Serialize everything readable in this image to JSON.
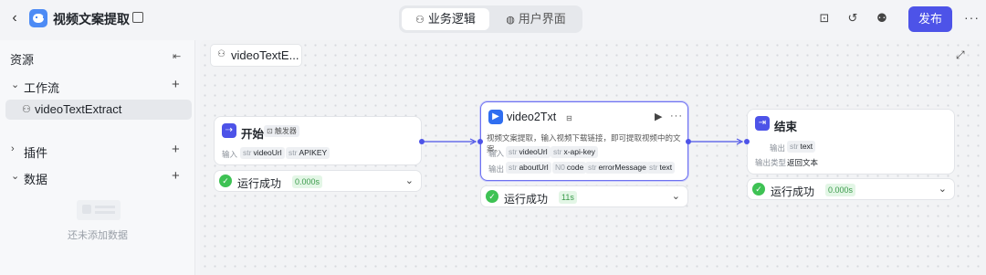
{
  "header": {
    "back_icon": "chevron-left-icon",
    "app_title": "视频文案提取",
    "tabs": [
      {
        "label": "业务逻辑",
        "icon": "flow-icon",
        "active": true
      },
      {
        "label": "用户界面",
        "icon": "palette-icon",
        "active": false
      }
    ],
    "publish_label": "发布",
    "publish_color": "#4d53e8"
  },
  "sidebar": {
    "title": "资源",
    "sections": [
      {
        "label": "工作流",
        "expanded": true
      },
      {
        "label": "插件",
        "expanded": false
      },
      {
        "label": "数据",
        "expanded": true
      }
    ],
    "workflow_item": "videoTextExtract",
    "empty_text": "还未添加数据"
  },
  "canvas": {
    "tab_label": "videoTextE...",
    "nodes": {
      "start": {
        "title": "开始",
        "badge": "⊡ 触发器",
        "input_label": "输入",
        "inputs": [
          {
            "type": "str",
            "name": "videoUrl"
          },
          {
            "type": "str",
            "name": "APIKEY"
          }
        ],
        "status": "运行成功",
        "time": "0.000s"
      },
      "video": {
        "title": "video2Txt",
        "description": "视频文案提取，输入视频下载链接，即可提取视频中的文案。",
        "input_label": "输入",
        "inputs": [
          {
            "type": "str",
            "name": "videoUrl"
          },
          {
            "type": "str",
            "name": "x-api-key"
          }
        ],
        "output_label": "输出",
        "outputs": [
          {
            "type": "str",
            "name": "aboutUrl"
          },
          {
            "type": "N0",
            "name": "code"
          },
          {
            "type": "str",
            "name": "errorMessage"
          },
          {
            "type": "str",
            "name": "text"
          }
        ],
        "status": "运行成功",
        "time": "11s"
      },
      "end": {
        "title": "结束",
        "output_label": "输出",
        "outputs": [
          {
            "type": "str",
            "name": "text"
          }
        ],
        "output_type_label": "输出类型",
        "output_type_value": "返回文本",
        "status": "运行成功",
        "time": "0.000s"
      }
    },
    "status_color": "#3ec254"
  }
}
